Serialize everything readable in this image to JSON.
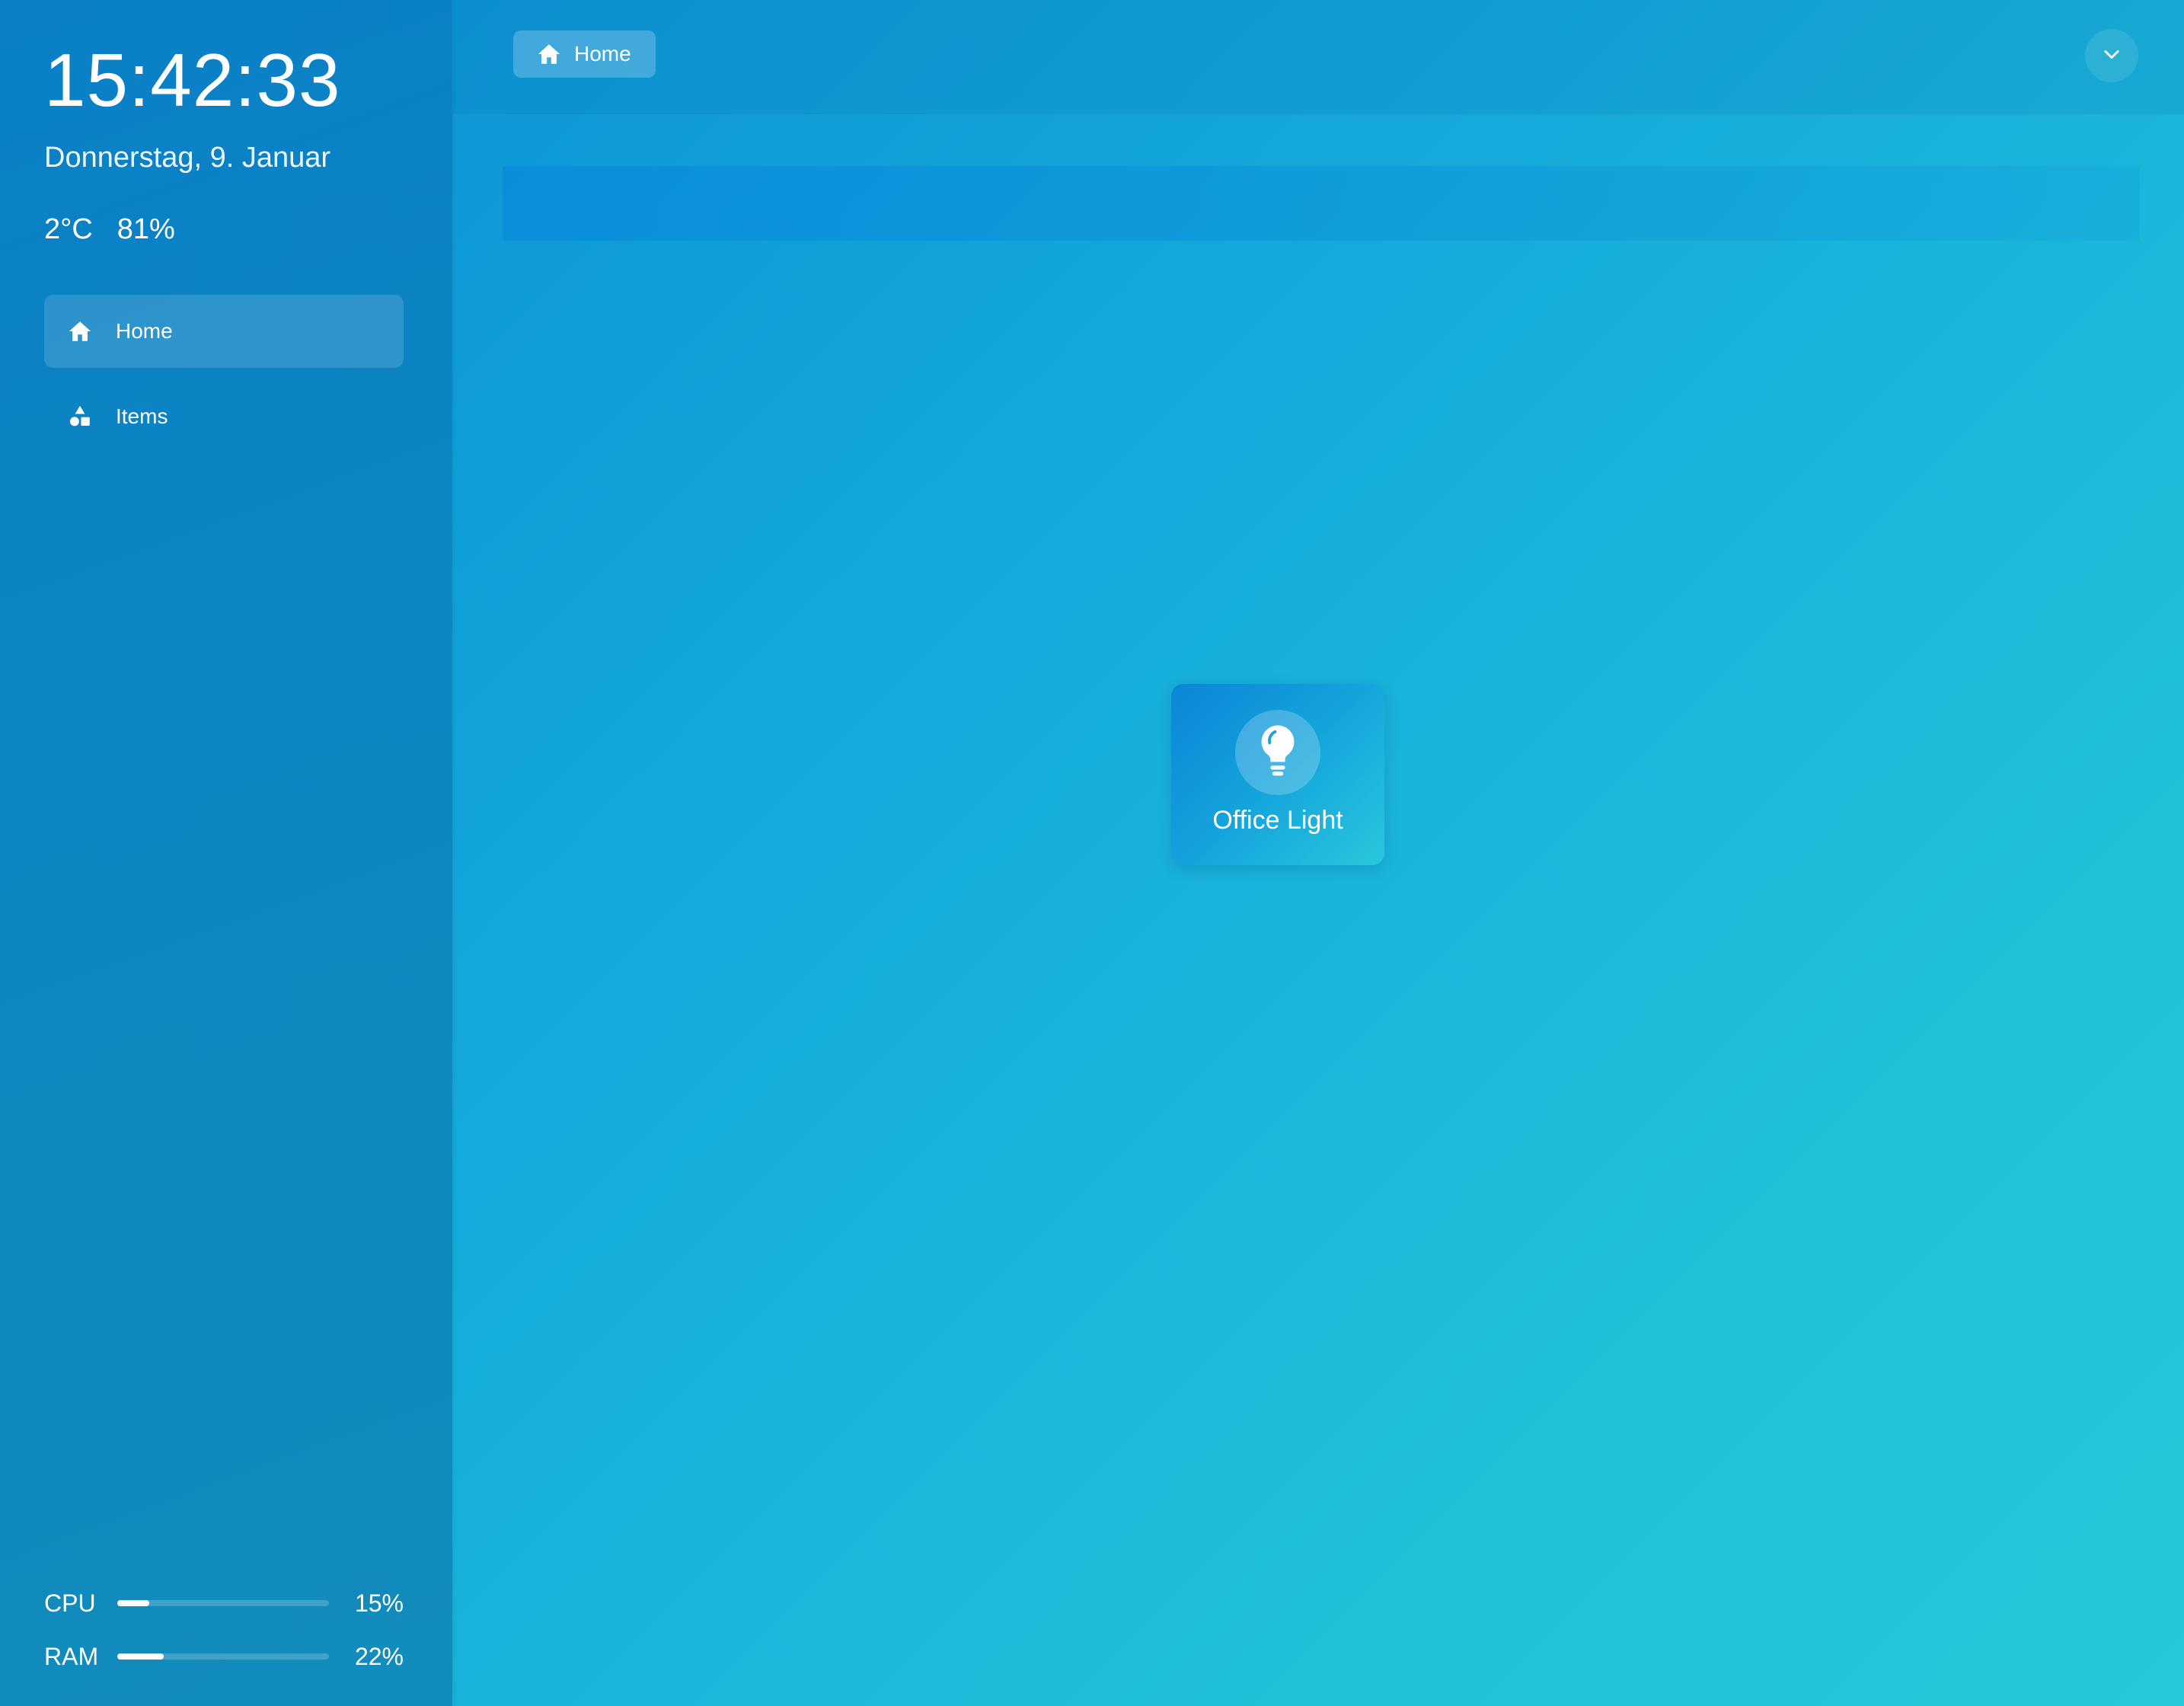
{
  "sidebar": {
    "clock": "15:42:33",
    "date": "Donnerstag, 9. Januar",
    "weather": {
      "temperature": "2°C",
      "humidity": "81%"
    },
    "nav": [
      {
        "label": "Home",
        "icon": "home-icon",
        "active": true
      },
      {
        "label": "Items",
        "icon": "shapes-icon",
        "active": false
      }
    ],
    "stats": {
      "cpu": {
        "label": "CPU",
        "value": "15%",
        "level": 0.15
      },
      "ram": {
        "label": "RAM",
        "value": "22%",
        "level": 0.22
      }
    }
  },
  "header": {
    "breadcrumb": {
      "label": "Home",
      "icon": "home-icon"
    },
    "menu_icon": "chevron-down-icon"
  },
  "main": {
    "tiles": [
      {
        "label": "Office Light",
        "icon": "lightbulb-icon"
      }
    ]
  },
  "colors": {
    "background_start": "#0a8fd8",
    "background_end": "#25c8da",
    "sidebar": "#0a7fc8"
  }
}
